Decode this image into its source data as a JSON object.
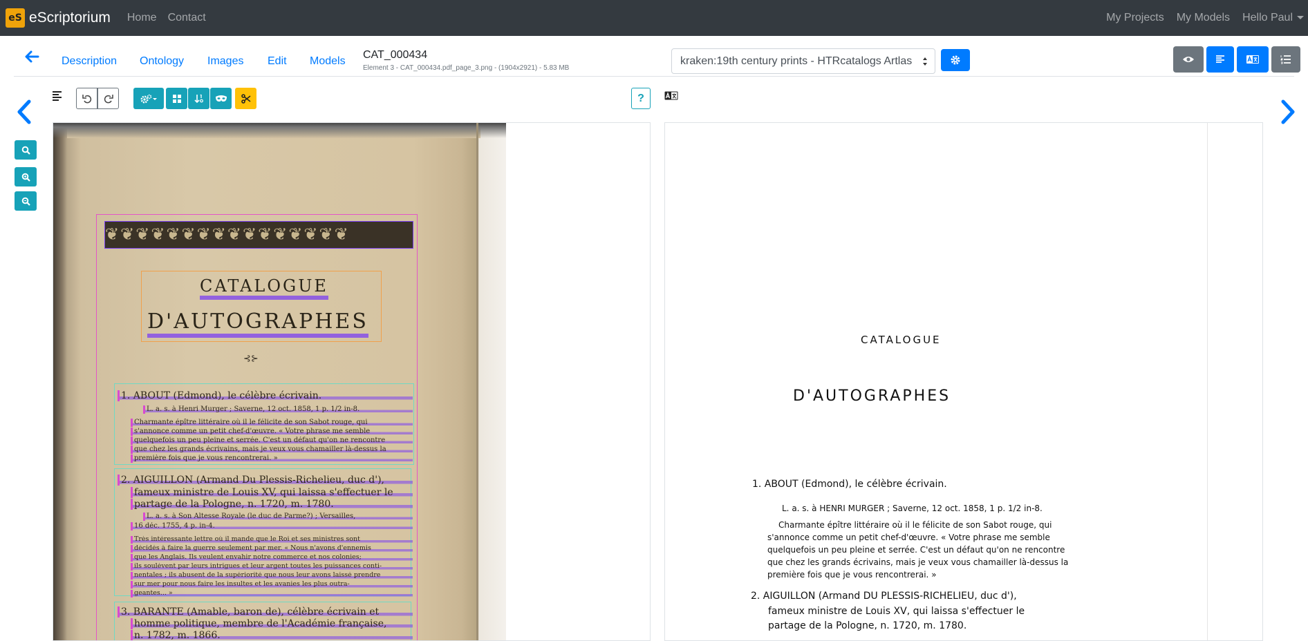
{
  "navbar": {
    "brand_logo": "eS",
    "brand": "eScriptorium",
    "links": [
      "Home",
      "Contact"
    ],
    "right_links": [
      "My Projects",
      "My Models",
      "Hello Paul"
    ]
  },
  "document": {
    "tabs": [
      "Description",
      "Ontology",
      "Images",
      "Edit",
      "Models"
    ],
    "title": "CAT_000434",
    "subtitle": "Element 3 - CAT_000434.pdf_page_3.png - (1904x2921) - 5.83 MB",
    "transcription_select": "kraken:19th century prints - HTRcatalogs Artlas"
  },
  "toolbar": {
    "help_label": "?"
  },
  "colors": {
    "navbar_bg": "#343a40",
    "primary": "#007bff",
    "info": "#17a2b8",
    "secondary": "#6c757d",
    "warning": "#ffc107",
    "region_main": "#e455c8",
    "region_title": "#f0a04b",
    "region_entry": "#6fd9c4",
    "line_mask": "#7b3ff2"
  },
  "icons": {
    "back": "arrow-left-icon",
    "settings": "gear-icon",
    "eye": "eye-icon",
    "segmentation": "align-left-icon",
    "translate": "language-icon",
    "list": "list-ol-icon",
    "undo": "undo-icon",
    "redo": "redo-icon",
    "search": "search-icon",
    "zoom_in": "zoom-in-icon",
    "zoom_out": "zoom-out-icon",
    "scissors": "scissors-icon"
  },
  "page_image": {
    "ornament": "❦❦❦❦❦❦❦❦❦❦❦❦❦❦❦❦",
    "title_1": "CATALOGUE",
    "title_2": "D'AUTOGRAPHES",
    "divider": "⊰⊱",
    "entries": [
      "1. ABOUT (Edmond), le célèbre écrivain.",
      "L. a. s. à Henri Murger ; Saverne, 12 oct. 1858, 1 p. 1/2 in-8.",
      "Charmante épître littéraire où il le félicite de son Sabot rouge, qui",
      "s'annonce comme un petit chef-d'œuvre. « Votre phrase me semble",
      "quelquefois un peu pleine et serrée. C'est un défaut qu'on ne rencontre",
      "que chez les grands écrivains, mais je veux vous chamailler là-dessus la",
      "première fois que je vous rencontrerai. »",
      "2. AIGUILLON (Armand Du Plessis-Richelieu, duc d'),",
      "fameux ministre de Louis XV, qui laissa s'effectuer le",
      "partage de la Pologne, n. 1720, m. 1780.",
      "L. a. s. à Son Altesse Royale (le duc de Parme?) ; Versailles,",
      "16 déc. 1755, 4 p. in-4.",
      "Très intéressante lettre où il mande que le Roi et ses ministres sont",
      "décidés à faire la guerre seulement par mer. « Nous n'avons d'ennemis",
      "que les Anglais. Ils veulent envahir notre commerce et nos colonies;",
      "ils soulèvent par leurs intrigues et leur argent toutes les puissances conti-",
      "nentales ; ils abusent de la supériorité que nous leur avons laissé prendre",
      "sur mer pour nous faire les insultes et les avanies les plus outra-",
      "geantes... »",
      "3. BARANTE (Amable, baron de), célèbre écrivain et",
      "homme politique, membre de l'Académie française,",
      "n. 1782, m. 1866."
    ]
  },
  "transcription": {
    "title_1": "CATALOGUE",
    "title_2": "D'AUTOGRAPHES",
    "lines": [
      "1. ABOUT (Edmond), le célèbre écrivain.",
      "L. a. s. à HENRI MURGER ; Saverne, 12 oct. 1858, 1 p. 1/2 in-8.",
      "Charmante épître littéraire où il le félicite de son Sabot rouge, qui",
      "s'annonce comme un petit chef-d'œuvre. « Votre phrase me semble",
      "quelquefois un peu pleine et serrée. C'est un défaut qu'on ne rencontre",
      "que chez les grands écrivains, mais je veux vous chamailler là-dessus la",
      "première fois que je vous rencontrerai. »",
      "2. AIGUILLON (Armand DU PLESSIS-RICHELIEU, duc d'),",
      "fameux ministre de Louis XV, qui laissa s'effectuer le",
      "partage de la Pologne, n. 1720, m. 1780."
    ]
  }
}
